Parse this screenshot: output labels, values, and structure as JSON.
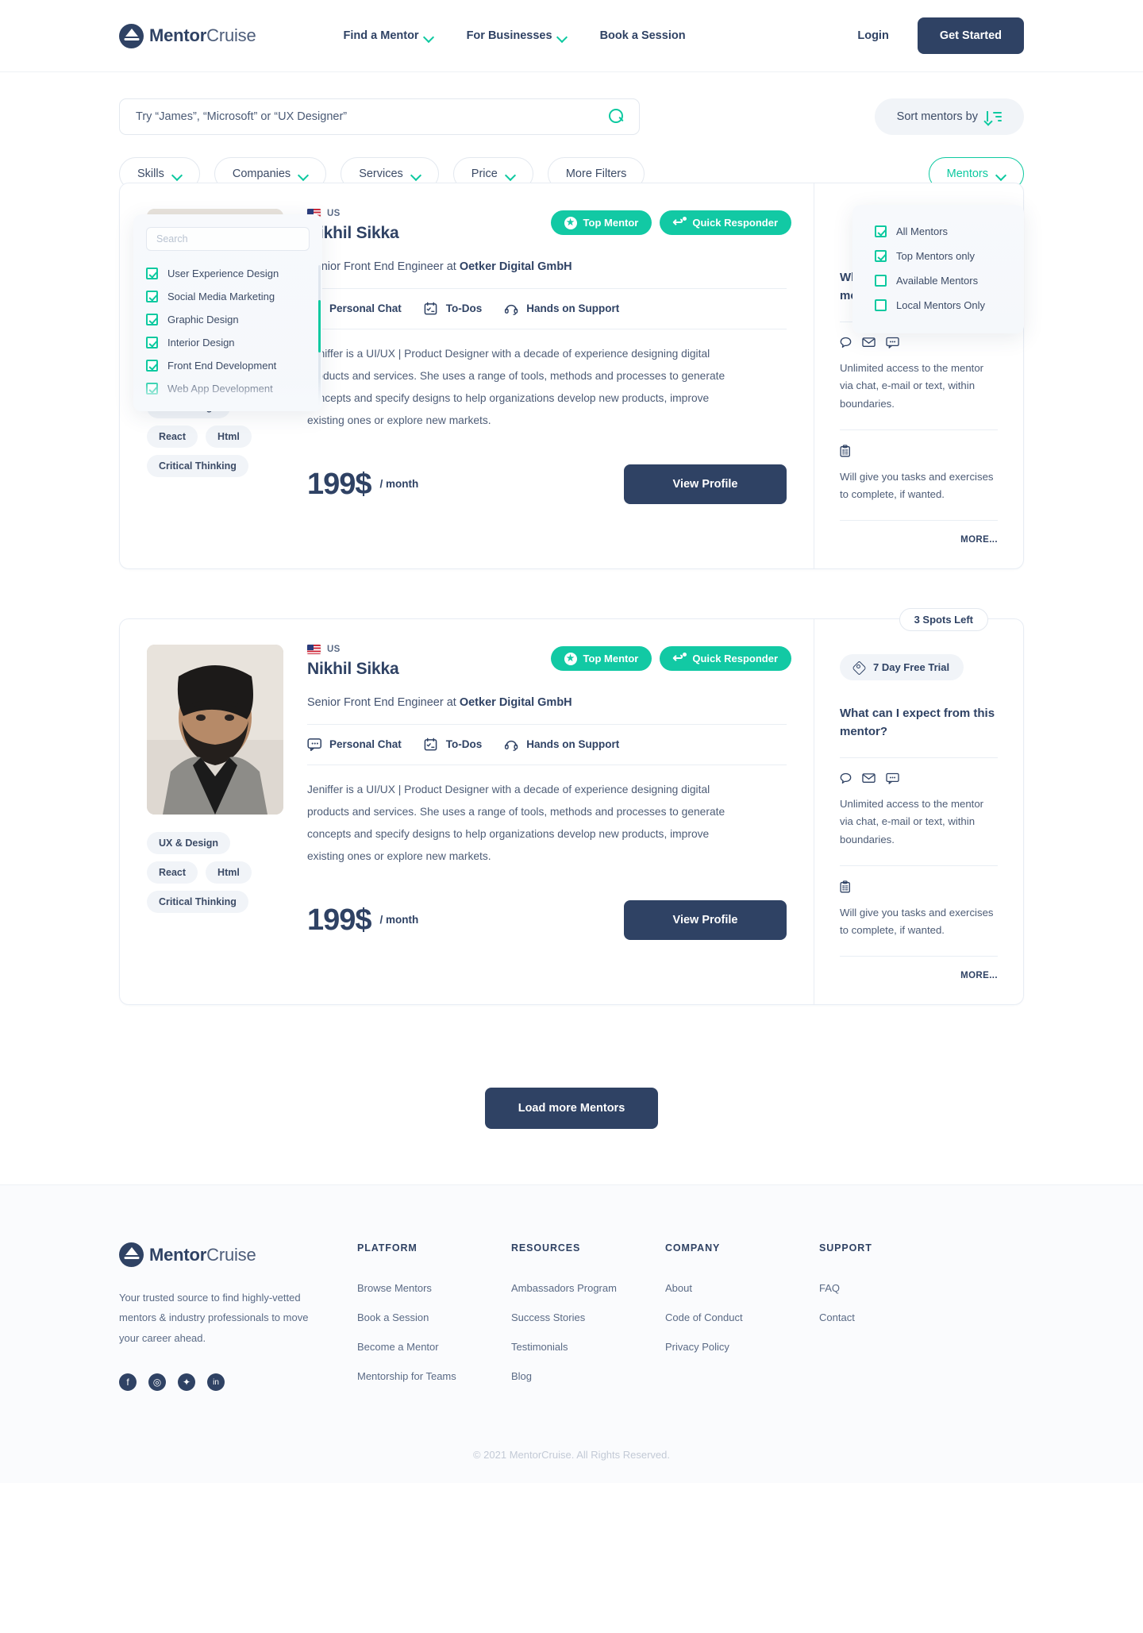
{
  "header": {
    "logo": {
      "bold": "Mentor",
      "light": "Cruise"
    },
    "nav": [
      {
        "label": "Find a Mentor",
        "has_chevron": true
      },
      {
        "label": "For Businesses",
        "has_chevron": true
      },
      {
        "label": "Book a Session",
        "has_chevron": false
      }
    ],
    "login_label": "Login",
    "cta_label": "Get Started"
  },
  "search": {
    "placeholder": "Try “James”, “Microsoft” or “UX Designer”",
    "value": "",
    "sort_label": "Sort mentors by"
  },
  "filters": {
    "pills": [
      {
        "label": "Skills",
        "has_chevron": true
      },
      {
        "label": "Companies",
        "has_chevron": true
      },
      {
        "label": "Services",
        "has_chevron": true
      },
      {
        "label": "Price",
        "has_chevron": true
      },
      {
        "label": "More Filters",
        "has_chevron": false
      }
    ],
    "mentors_pill": {
      "label": "Mentors",
      "has_chevron": true
    }
  },
  "skills_dropdown": {
    "search_placeholder": "Search",
    "items": [
      {
        "label": "User Experience Design",
        "checked": true
      },
      {
        "label": "Social Media Marketing",
        "checked": true
      },
      {
        "label": "Graphic Design",
        "checked": true
      },
      {
        "label": "Interior Design",
        "checked": true
      },
      {
        "label": "Front End Development",
        "checked": true
      },
      {
        "label": "Web App Development",
        "checked": true
      }
    ]
  },
  "mentors_dropdown": {
    "items": [
      {
        "label": "All Mentors",
        "checked": true
      },
      {
        "label": "Top Mentors only",
        "checked": true
      },
      {
        "label": "Available Mentors",
        "checked": false
      },
      {
        "label": "Local Mentors Only",
        "checked": false
      }
    ]
  },
  "mentor_card": {
    "country_code": "US",
    "name": "Nikhil Sikka",
    "role_prefix": "Senior Front End Engineer at ",
    "company": "Oetker Digital GmbH",
    "badges": [
      {
        "label": "Top Mentor",
        "icon": "star-icon"
      },
      {
        "label": "Quick Responder",
        "icon": "reply-icon"
      }
    ],
    "features": [
      {
        "label": "Personal Chat",
        "icon": "chat-icon"
      },
      {
        "label": "To-Dos",
        "icon": "calendar-icon"
      },
      {
        "label": "Hands on Support",
        "icon": "headset-icon"
      }
    ],
    "description": "Jeniffer is a UI/UX | Product Designer with a decade of experience designing digital products and services. She uses a range of tools, methods and processes to generate concepts and specify designs to help organizations develop new products, improve existing ones or explore new markets.",
    "tags": [
      "UX & Design",
      "React",
      "Html",
      "Critical Thinking"
    ],
    "price": "199$",
    "price_period": "/ month",
    "view_profile_label": "View Profile",
    "side": {
      "trial_label": "7 Day Free Trial",
      "question": "What can I expect from this mentor?",
      "benefit_1": "Unlimited access to the mentor via chat, e-mail or text, within boundaries.",
      "benefit_2": "Will give you tasks and exercises to complete, if wanted.",
      "more_label": "MORE..."
    },
    "spots_label": "3 Spots Left"
  },
  "load_more_label": "Load more Mentors",
  "footer": {
    "logo": {
      "bold": "Mentor",
      "light": "Cruise"
    },
    "description": "Your trusted source to find highly-vetted mentors & industry professionals to move your career ahead.",
    "socials": [
      "facebook-icon",
      "instagram-icon",
      "twitter-icon",
      "linkedin-icon"
    ],
    "columns": [
      {
        "title": "PLATFORM",
        "links": [
          "Browse Mentors",
          "Book a Session",
          "Become a Mentor",
          "Mentorship for Teams"
        ]
      },
      {
        "title": "RESOURCES",
        "links": [
          "Ambassadors Program",
          "Success Stories",
          "Testimonials",
          "Blog"
        ]
      },
      {
        "title": "COMPANY",
        "links": [
          "About",
          "Code of Conduct",
          "Privacy Policy"
        ]
      },
      {
        "title": "SUPPORT",
        "links": [
          "FAQ",
          "Contact"
        ]
      }
    ],
    "copyright": "© 2021 MentorCruise. All Rights Reserved."
  },
  "colors": {
    "accent": "#0dc9a0",
    "brand": "#2f4264",
    "badge": "#12c9a4"
  }
}
